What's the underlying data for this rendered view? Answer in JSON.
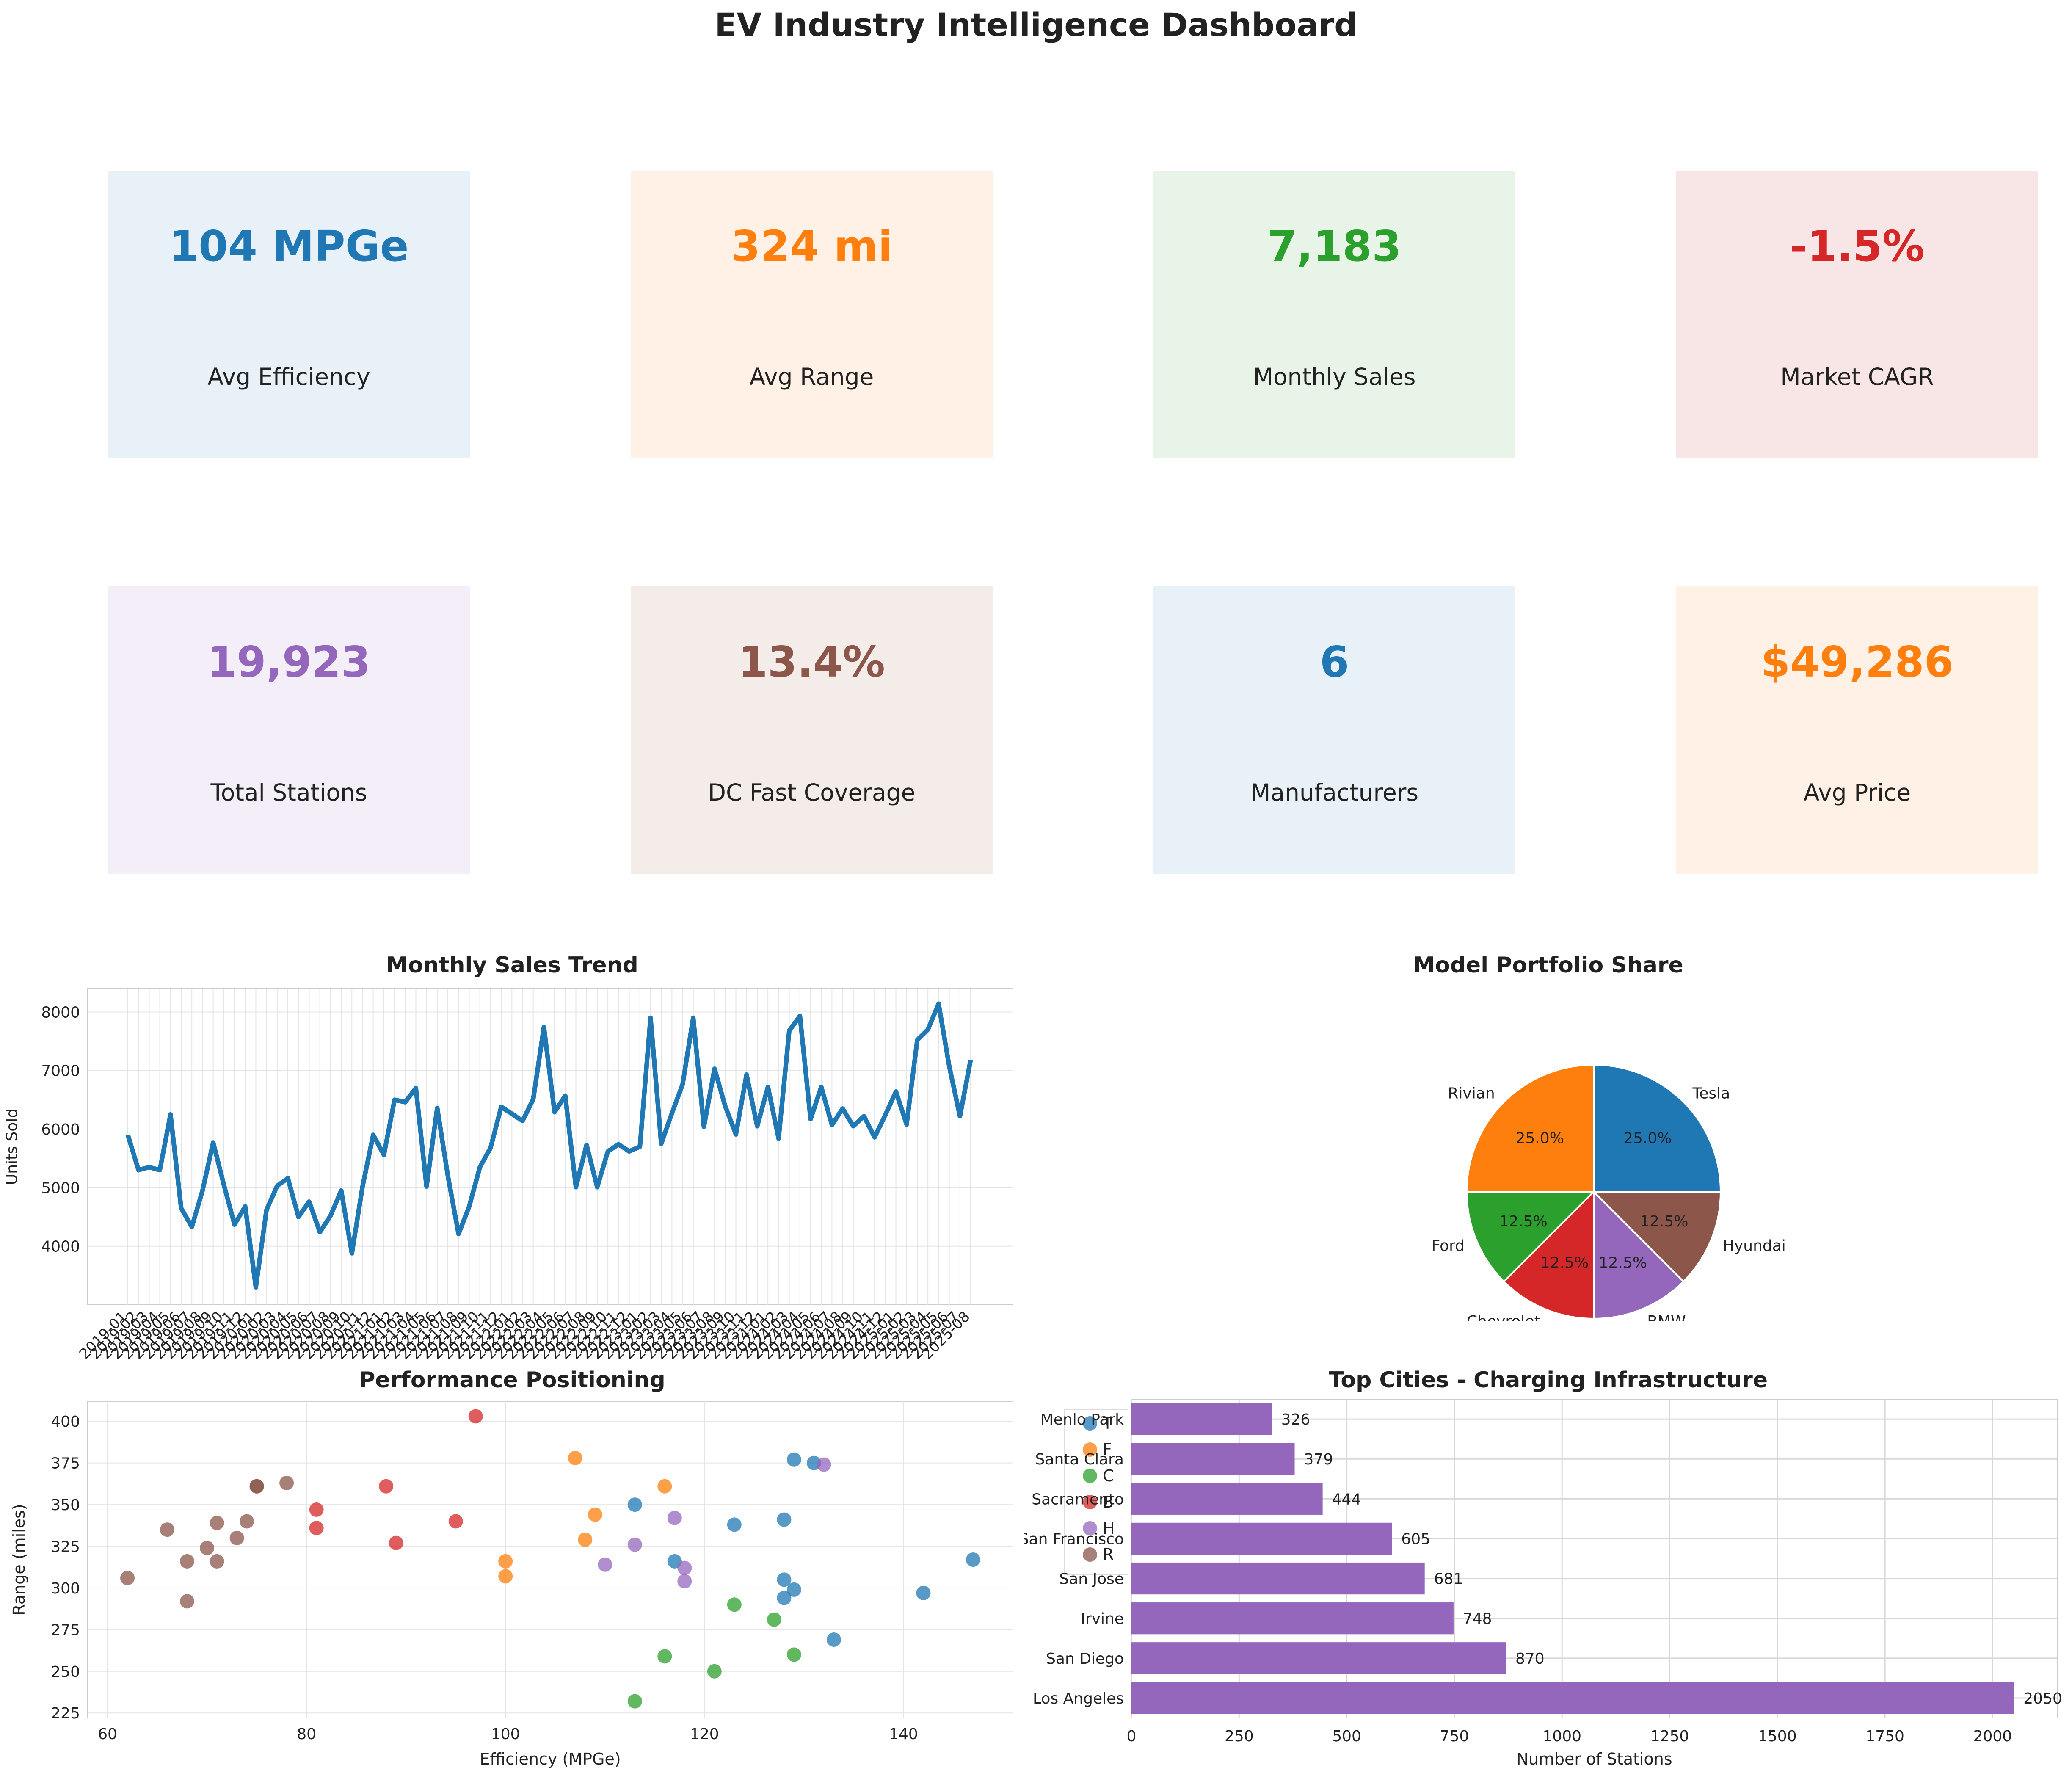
{
  "title": "EV Industry Intelligence Dashboard",
  "kpis": [
    {
      "value": "104 MPGe",
      "label": "Avg Efficiency",
      "color": "#1f77b4",
      "bg": "#e8f0f8"
    },
    {
      "value": "324 mi",
      "label": "Avg Range",
      "color": "#ff7f0e",
      "bg": "#fff1e6"
    },
    {
      "value": "7,183",
      "label": "Monthly Sales",
      "color": "#2ca02c",
      "bg": "#e9f4e9"
    },
    {
      "value": "-1.5%",
      "label": "Market CAGR",
      "color": "#d62728",
      "bg": "#f8e6e6"
    },
    {
      "value": "19,923",
      "label": "Total Stations",
      "color": "#9467bd",
      "bg": "#f3eef8"
    },
    {
      "value": "13.4%",
      "label": "DC Fast Coverage",
      "color": "#8c564b",
      "bg": "#f3ece9"
    },
    {
      "value": "6",
      "label": "Manufacturers",
      "color": "#1f77b4",
      "bg": "#e8f0f8"
    },
    {
      "value": "$49,286",
      "label": "Avg Price",
      "color": "#ff7f0e",
      "bg": "#fff1e6"
    }
  ],
  "chart_data": [
    {
      "type": "line",
      "title": "Monthly Sales Trend",
      "xlabel": "",
      "ylabel": "Units Sold",
      "x": [
        "2019-01",
        "2019-02",
        "2019-03",
        "2019-04",
        "2019-05",
        "2019-06",
        "2019-07",
        "2019-08",
        "2019-09",
        "2019-10",
        "2019-11",
        "2019-12",
        "2020-01",
        "2020-02",
        "2020-03",
        "2020-04",
        "2020-05",
        "2020-06",
        "2020-07",
        "2020-08",
        "2020-09",
        "2020-10",
        "2020-11",
        "2020-12",
        "2021-01",
        "2021-02",
        "2021-03",
        "2021-04",
        "2021-05",
        "2021-06",
        "2021-07",
        "2021-08",
        "2021-09",
        "2021-10",
        "2021-11",
        "2021-12",
        "2022-01",
        "2022-02",
        "2022-03",
        "2022-04",
        "2022-05",
        "2022-06",
        "2022-07",
        "2022-08",
        "2022-09",
        "2022-10",
        "2022-11",
        "2022-12",
        "2023-01",
        "2023-02",
        "2023-03",
        "2023-04",
        "2023-05",
        "2023-06",
        "2023-07",
        "2023-08",
        "2023-09",
        "2023-10",
        "2023-11",
        "2023-12",
        "2024-01",
        "2024-02",
        "2024-03",
        "2024-04",
        "2024-05",
        "2024-06",
        "2024-07",
        "2024-08",
        "2024-09",
        "2024-10",
        "2024-11",
        "2024-12",
        "2025-01",
        "2025-02",
        "2025-03",
        "2025-04",
        "2025-05",
        "2025-06",
        "2025-07",
        "2025-08"
      ],
      "values": [
        5900,
        5300,
        5350,
        5300,
        6250,
        4650,
        4330,
        4950,
        5770,
        5050,
        4370,
        4680,
        3300,
        4620,
        5030,
        5160,
        4500,
        4760,
        4240,
        4520,
        4950,
        3880,
        5020,
        5900,
        5560,
        6500,
        6460,
        6700,
        5020,
        6360,
        5200,
        4210,
        4680,
        5350,
        5680,
        6380,
        6260,
        6140,
        6510,
        7740,
        6290,
        6570,
        5010,
        5730,
        5010,
        5620,
        5740,
        5620,
        5700,
        7900,
        5750,
        6270,
        6760,
        7900,
        6040,
        7030,
        6390,
        5910,
        6930,
        6050,
        6720,
        5840,
        7680,
        7930,
        6170,
        6720,
        6070,
        6350,
        6050,
        6220,
        5860,
        6240,
        6640,
        6080,
        7520,
        7700,
        8140,
        7070,
        6220,
        7180
      ],
      "ylim": [
        3000,
        8400
      ],
      "yticks": [
        4000,
        5000,
        6000,
        7000,
        8000
      ],
      "grid": true,
      "color": "#1f77b4"
    },
    {
      "type": "pie",
      "title": "Model Portfolio Share",
      "slices": [
        {
          "label": "Tesla",
          "value": 25.0,
          "pct": "25.0%",
          "color": "#1f77b4"
        },
        {
          "label": "Hyundai",
          "value": 12.5,
          "pct": "12.5%",
          "color": "#8c564b"
        },
        {
          "label": "BMW",
          "value": 12.5,
          "pct": "12.5%",
          "color": "#9467bd"
        },
        {
          "label": "Chevrolet",
          "value": 12.5,
          "pct": "12.5%",
          "color": "#d62728"
        },
        {
          "label": "Ford",
          "value": 12.5,
          "pct": "12.5%",
          "color": "#2ca02c"
        },
        {
          "label": "Rivian",
          "value": 25.0,
          "pct": "25.0%",
          "color": "#ff7f0e"
        }
      ]
    },
    {
      "type": "scatter",
      "title": "Performance Positioning",
      "xlabel": "Efficiency (MPGe)",
      "ylabel": "Range (miles)",
      "xlim": [
        58,
        151
      ],
      "ylim": [
        222,
        412
      ],
      "xticks": [
        60,
        80,
        100,
        120,
        140
      ],
      "yticks": [
        225,
        250,
        275,
        300,
        325,
        350,
        375,
        400
      ],
      "legend": "top-right",
      "series": [
        {
          "name": "T",
          "color": "#1f77b4",
          "points": [
            [
              113,
              350
            ],
            [
              117,
              316
            ],
            [
              123,
              338
            ],
            [
              128,
              341
            ],
            [
              128,
              305
            ],
            [
              128,
              294
            ],
            [
              129,
              377
            ],
            [
              129,
              299
            ],
            [
              131,
              375
            ],
            [
              133,
              269
            ],
            [
              142,
              297
            ],
            [
              147,
              317
            ]
          ]
        },
        {
          "name": "F",
          "color": "#ff7f0e",
          "points": [
            [
              100,
              316
            ],
            [
              100,
              307
            ],
            [
              107,
              378
            ],
            [
              108,
              329
            ],
            [
              109,
              344
            ],
            [
              116,
              361
            ]
          ]
        },
        {
          "name": "C",
          "color": "#2ca02c",
          "points": [
            [
              113,
              232
            ],
            [
              116,
              259
            ],
            [
              121,
              250
            ],
            [
              123,
              290
            ],
            [
              127,
              281
            ],
            [
              129,
              260
            ]
          ]
        },
        {
          "name": "B",
          "color": "#d62728",
          "points": [
            [
              81,
              347
            ],
            [
              81,
              336
            ],
            [
              88,
              361
            ],
            [
              89,
              327
            ],
            [
              95,
              340
            ],
            [
              97,
              403
            ]
          ]
        },
        {
          "name": "H",
          "color": "#9467bd",
          "points": [
            [
              110,
              314
            ],
            [
              113,
              326
            ],
            [
              117,
              342
            ],
            [
              118,
              312
            ],
            [
              118,
              304
            ],
            [
              132,
              374
            ]
          ]
        },
        {
          "name": "R",
          "color": "#8c564b",
          "points": [
            [
              62,
              306
            ],
            [
              66,
              335
            ],
            [
              68,
              316
            ],
            [
              68,
              292
            ],
            [
              70,
              324
            ],
            [
              71,
              339
            ],
            [
              71,
              316
            ],
            [
              73,
              330
            ],
            [
              74,
              340
            ],
            [
              75,
              361
            ],
            [
              75,
              361
            ],
            [
              78,
              363
            ]
          ]
        }
      ]
    },
    {
      "type": "bar",
      "orientation": "horizontal",
      "title": "Top Cities - Charging Infrastructure",
      "xlabel": "Number of Stations",
      "ylabel": "",
      "categories": [
        "Los Angeles",
        "San Diego",
        "Irvine",
        "San Jose",
        "San Francisco",
        "Sacramento",
        "Santa Clara",
        "Menlo Park"
      ],
      "values": [
        2050,
        870,
        748,
        681,
        605,
        444,
        379,
        326
      ],
      "xlim": [
        0,
        2150
      ],
      "xticks": [
        0,
        250,
        500,
        750,
        1000,
        1250,
        1500,
        1750,
        2000
      ],
      "color": "#9467bd"
    }
  ]
}
